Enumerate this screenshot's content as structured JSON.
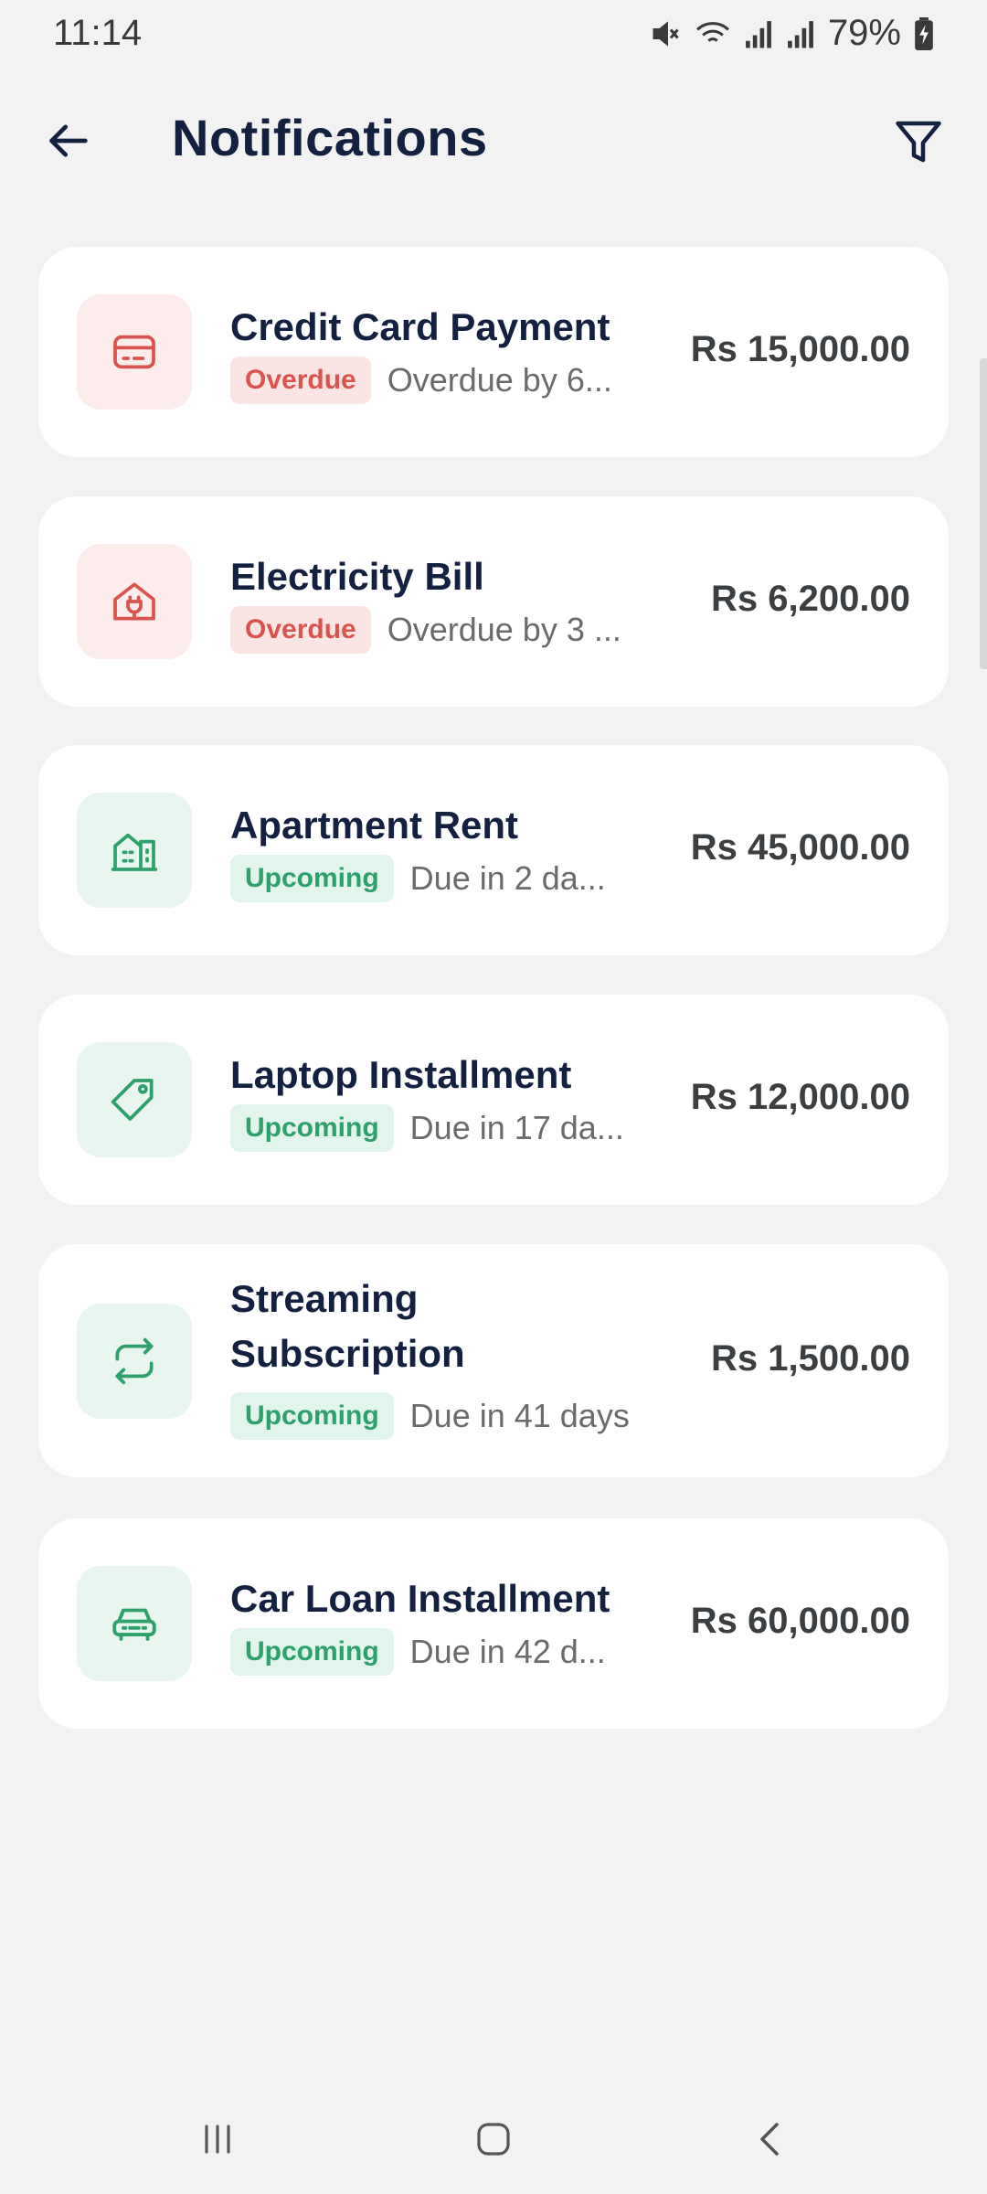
{
  "status_bar": {
    "time": "11:14",
    "battery": "79%"
  },
  "header": {
    "title": "Notifications"
  },
  "notifications": [
    {
      "title": "Credit Card Payment",
      "status": "Overdue",
      "detail": "Overdue by 6...",
      "amount": "Rs 15,000.00",
      "icon": "credit-card-icon",
      "status_color": "#d9534f"
    },
    {
      "title": "Electricity Bill",
      "status": "Overdue",
      "detail": "Overdue by 3 ...",
      "amount": "Rs 6,200.00",
      "icon": "home-plug-icon",
      "status_color": "#d9534f"
    },
    {
      "title": "Apartment Rent",
      "status": "Upcoming",
      "detail": "Due in 2 da...",
      "amount": "Rs 45,000.00",
      "icon": "building-icon",
      "status_color": "#2da06b"
    },
    {
      "title": "Laptop Installment",
      "status": "Upcoming",
      "detail": "Due in 17 da...",
      "amount": "Rs 12,000.00",
      "icon": "tag-icon",
      "status_color": "#2da06b"
    },
    {
      "title": "Streaming Subscription",
      "status": "Upcoming",
      "detail": "Due in 41 days",
      "amount": "Rs 1,500.00",
      "icon": "repeat-icon",
      "status_color": "#2da06b"
    },
    {
      "title": "Car Loan Installment",
      "status": "Upcoming",
      "detail": "Due in 42 d...",
      "amount": "Rs 60,000.00",
      "icon": "car-icon",
      "status_color": "#2da06b"
    }
  ]
}
